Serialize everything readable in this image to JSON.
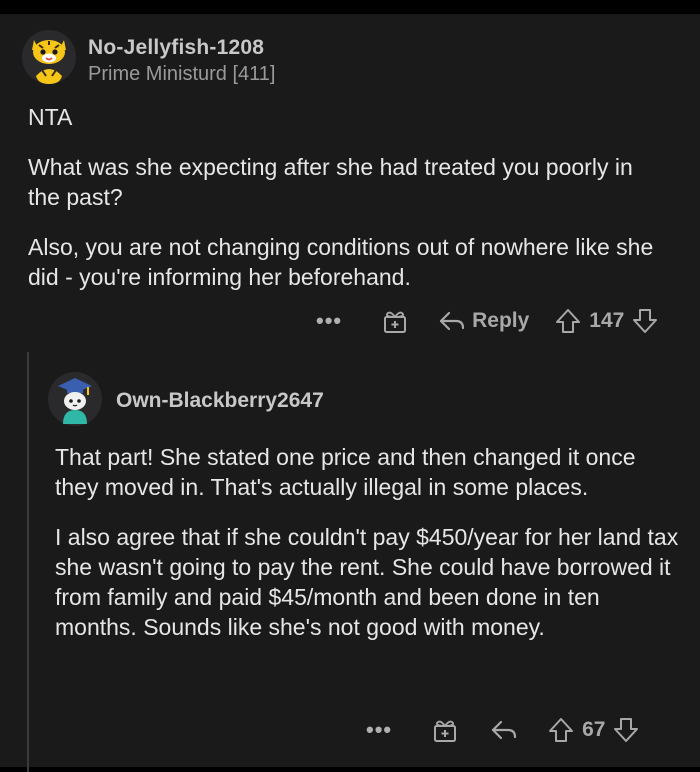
{
  "comment": {
    "username": "No-Jellyfish-1208",
    "flair": "Prime Ministurd [411]",
    "paragraphs": [
      "NTA",
      "What was she expecting after she had treated you poorly in the past?",
      "Also, you are not changing conditions out of nowhere like she did - you're informing her beforehand."
    ],
    "actions": {
      "more": "•••",
      "reply_label": "Reply",
      "score": "147"
    }
  },
  "reply": {
    "username": "Own-Blackberry2647",
    "paragraphs": [
      "That part! She stated one price and then changed it once they moved in. That's actually illegal in some places.",
      "I also agree that if she couldn't pay $450/year for her land tax she wasn't going to pay the rent. She could have borrowed it from family and paid $45/month and been done in ten months. Sounds like she's not good with money."
    ],
    "actions": {
      "more": "•••",
      "score": "67"
    }
  },
  "colors": {
    "background": "#1a1a1b",
    "text": "#e6e6e6",
    "muted": "#9c9c9c",
    "avatar_yellow": "#f5c518"
  }
}
